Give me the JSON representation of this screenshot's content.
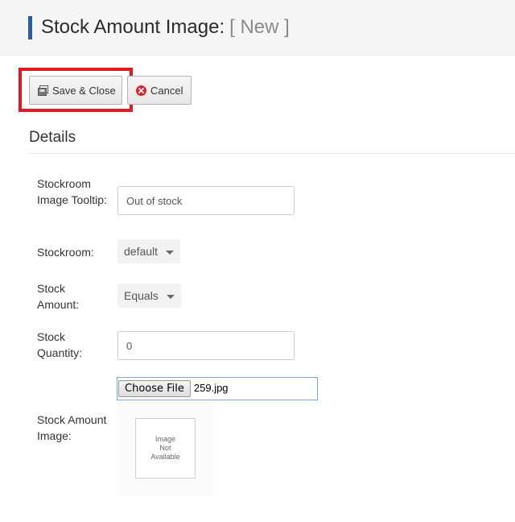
{
  "header": {
    "title": "Stock Amount Image:",
    "subtitle": "[ New ]"
  },
  "toolbar": {
    "save_close_label": "Save & Close",
    "cancel_label": "Cancel",
    "highlight_color": "#e21a23"
  },
  "section": {
    "title": "Details"
  },
  "form": {
    "tooltip_label": "Stockroom Image Tooltip:",
    "tooltip_value": "Out of stock",
    "stockroom_label": "Stockroom:",
    "stockroom_value": "default",
    "stock_amount_label": "Stock Amount:",
    "stock_amount_value": "Equals",
    "quantity_label": "Stock Quantity:",
    "quantity_value": "0",
    "image_label": "Stock Amount Image:",
    "file_button_label": "Choose File",
    "file_name": "259.jpg",
    "image_placeholder_lines": [
      "Image",
      "Not",
      "Available"
    ]
  },
  "icons": {
    "save": "save-icon",
    "cancel": "cancel-icon"
  }
}
